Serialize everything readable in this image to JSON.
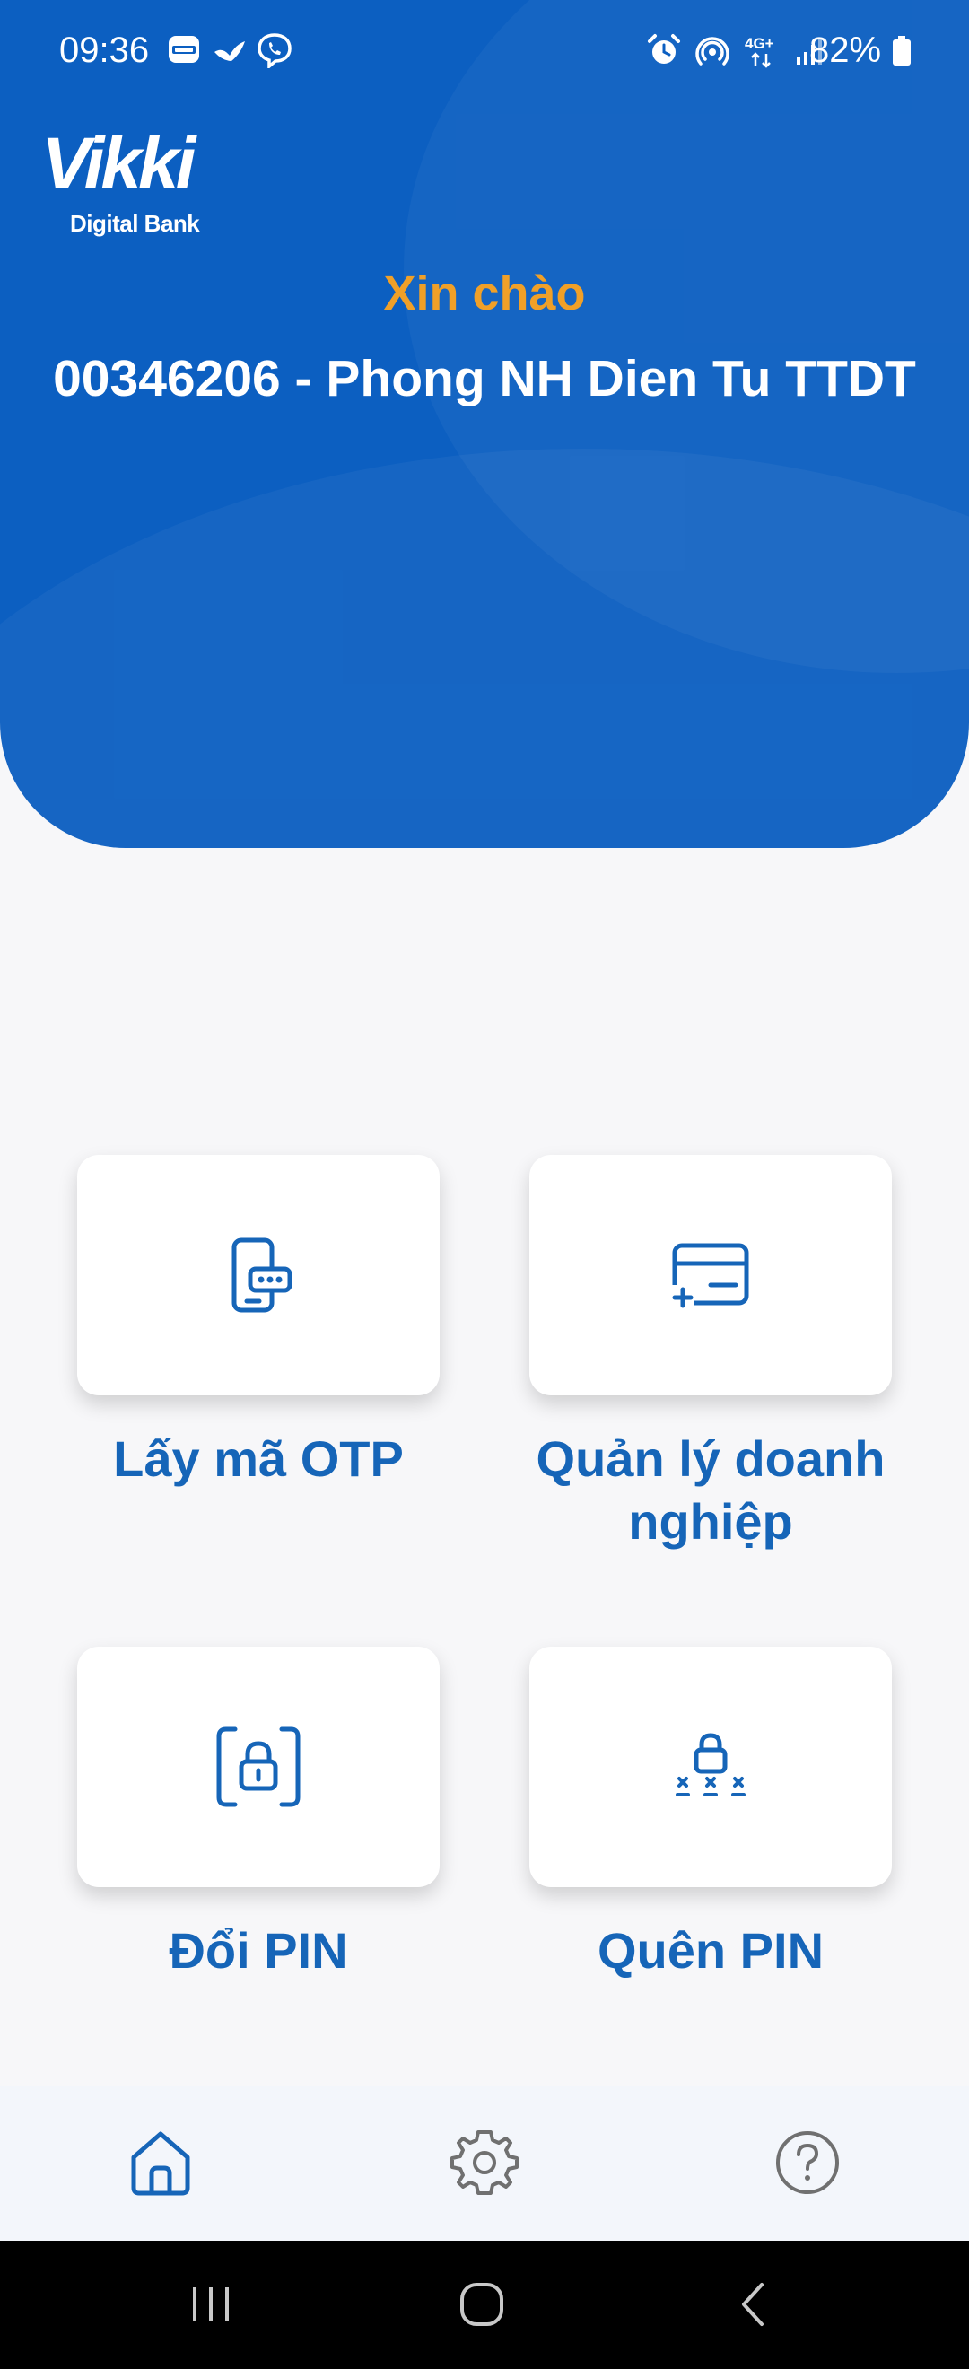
{
  "status_bar": {
    "time": "09:36",
    "battery_percent": "82%",
    "network_label": "4G+",
    "battery_level": 0.82,
    "icons": [
      "zalo-icon",
      "messenger-bird-icon",
      "viber-icon",
      "alarm-icon",
      "hotspot-icon",
      "network-4g-icon",
      "signal-icon",
      "battery-icon"
    ]
  },
  "brand": {
    "logo_text": "Vikki",
    "logo_subtext": "Digital Bank",
    "primary_color": "#0c5fc1",
    "accent_color": "#f0a028",
    "tile_text_color": "#1665b8"
  },
  "header": {
    "greeting": "Xin chào",
    "account_name": "00346206 - Phong NH Dien Tu TTDT"
  },
  "menu": {
    "items": [
      {
        "id": "otp",
        "label": "Lấy mã OTP",
        "icon": "phone-otp-icon"
      },
      {
        "id": "business",
        "label": "Quản lý doanh nghiệp",
        "icon": "card-add-icon"
      },
      {
        "id": "change-pin",
        "label": "Đổi PIN",
        "icon": "lock-frame-icon"
      },
      {
        "id": "forgot-pin",
        "label": "Quên PIN",
        "icon": "lock-asterisks-icon"
      }
    ]
  },
  "bottom_nav": {
    "items": [
      {
        "id": "home",
        "icon": "home-icon",
        "active": true
      },
      {
        "id": "settings",
        "icon": "gear-icon",
        "active": false
      },
      {
        "id": "help",
        "icon": "help-icon",
        "active": false
      }
    ]
  },
  "system_nav": {
    "items": [
      "recent-apps-icon",
      "home-circle-icon",
      "back-icon"
    ]
  }
}
